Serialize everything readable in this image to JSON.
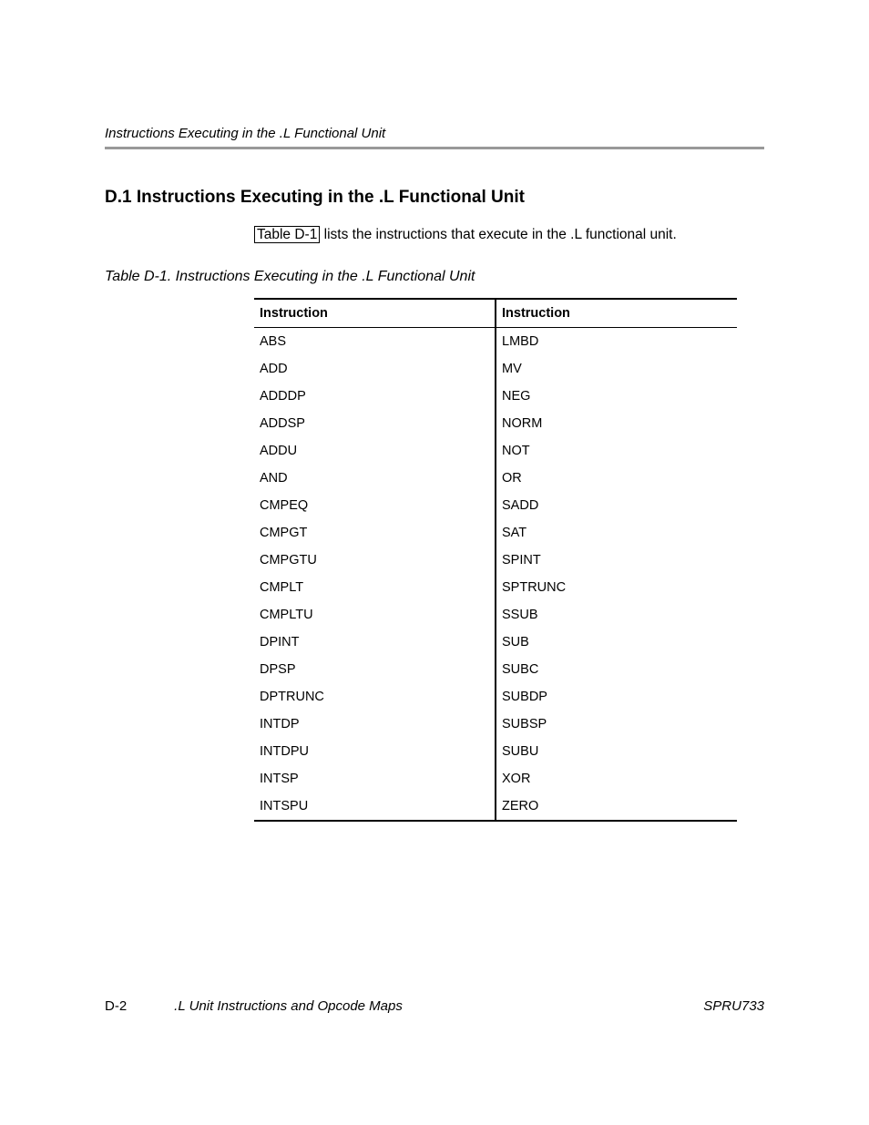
{
  "header": {
    "running_title": "Instructions Executing in the .L Functional Unit"
  },
  "section": {
    "heading": "D.1  Instructions Executing in the .L Functional Unit",
    "body_prefix": "Table D-1",
    "body_suffix": " lists the instructions that execute in the .L functional unit.",
    "table_caption": "Table D-1. Instructions Executing in the .L Functional Unit"
  },
  "table": {
    "col1_header": "Instruction",
    "col2_header": "Instruction",
    "rows": [
      {
        "left": "ABS",
        "right": "LMBD"
      },
      {
        "left": "ADD",
        "right": "MV"
      },
      {
        "left": "ADDDP",
        "right": "NEG"
      },
      {
        "left": "ADDSP",
        "right": "NORM"
      },
      {
        "left": "ADDU",
        "right": "NOT"
      },
      {
        "left": "AND",
        "right": "OR"
      },
      {
        "left": "CMPEQ",
        "right": "SADD"
      },
      {
        "left": "CMPGT",
        "right": "SAT"
      },
      {
        "left": "CMPGTU",
        "right": "SPINT"
      },
      {
        "left": "CMPLT",
        "right": "SPTRUNC"
      },
      {
        "left": "CMPLTU",
        "right": "SSUB"
      },
      {
        "left": "DPINT",
        "right": "SUB"
      },
      {
        "left": "DPSP",
        "right": "SUBC"
      },
      {
        "left": "DPTRUNC",
        "right": "SUBDP"
      },
      {
        "left": "INTDP",
        "right": "SUBSP"
      },
      {
        "left": "INTDPU",
        "right": "SUBU"
      },
      {
        "left": "INTSP",
        "right": "XOR"
      },
      {
        "left": "INTSPU",
        "right": "ZERO"
      }
    ]
  },
  "footer": {
    "page_number": "D-2",
    "book_title": ".L Unit Instructions and Opcode Maps",
    "doc_id": "SPRU733"
  }
}
